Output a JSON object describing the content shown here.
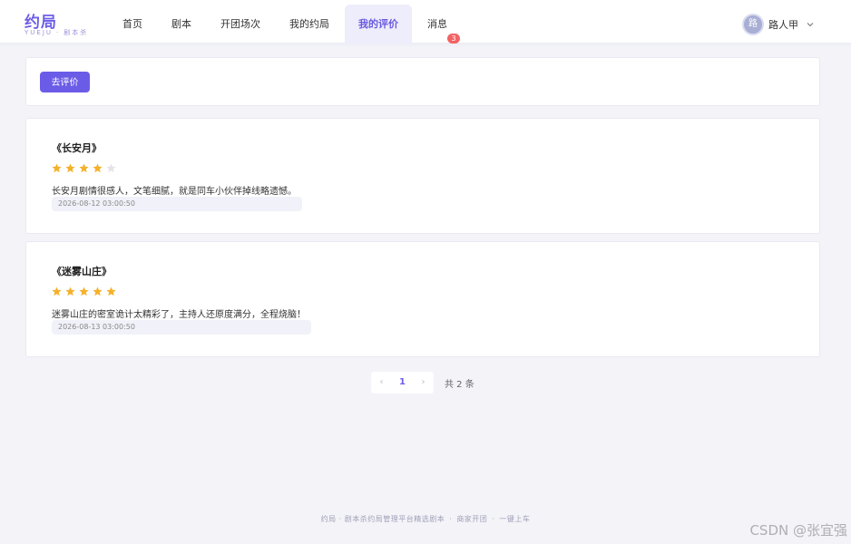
{
  "header": {
    "logo": "约局",
    "logo_sub_a": "YUEJU",
    "logo_sub_sep": "·",
    "logo_sub_b": "剧本杀",
    "nav": [
      {
        "label": "首页"
      },
      {
        "label": "剧本"
      },
      {
        "label": "开团场次"
      },
      {
        "label": "我的约局"
      },
      {
        "label": "我的评价"
      },
      {
        "label": "消息"
      }
    ],
    "active_nav": "我的评价",
    "message_badge": "3",
    "user": {
      "avatar_text": "路",
      "name": "路人甲"
    }
  },
  "actions": {
    "go_review_label": "去评价"
  },
  "reviews": [
    {
      "title": "《长安月》",
      "rating": 4,
      "max_rating": 5,
      "text": "长安月剧情很感人，文笔细腻，就是同车小伙伴掉线略遗憾。",
      "time": "2026-08-12 03:00:50"
    },
    {
      "title": "《迷雾山庄》",
      "rating": 5,
      "max_rating": 5,
      "text": "迷雾山庄的密室诡计太精彩了，主持人还原度满分，全程烧脑！",
      "time": "2026-08-13 03:00:50"
    }
  ],
  "pagination": {
    "prev": "‹",
    "current": "1",
    "next": "›",
    "total_text": "共 2 条"
  },
  "footer": {
    "part1": "约局 · 剧本杀约局管理平台精选剧本",
    "part2": "商家开团",
    "part3": "一键上车",
    "sep": "·"
  },
  "watermark": "CSDN @张宜强",
  "colors": {
    "accent": "#6b5ce7",
    "star_on": "#f5b12a",
    "star_off": "#e4e4ea",
    "badge": "#f26363"
  }
}
